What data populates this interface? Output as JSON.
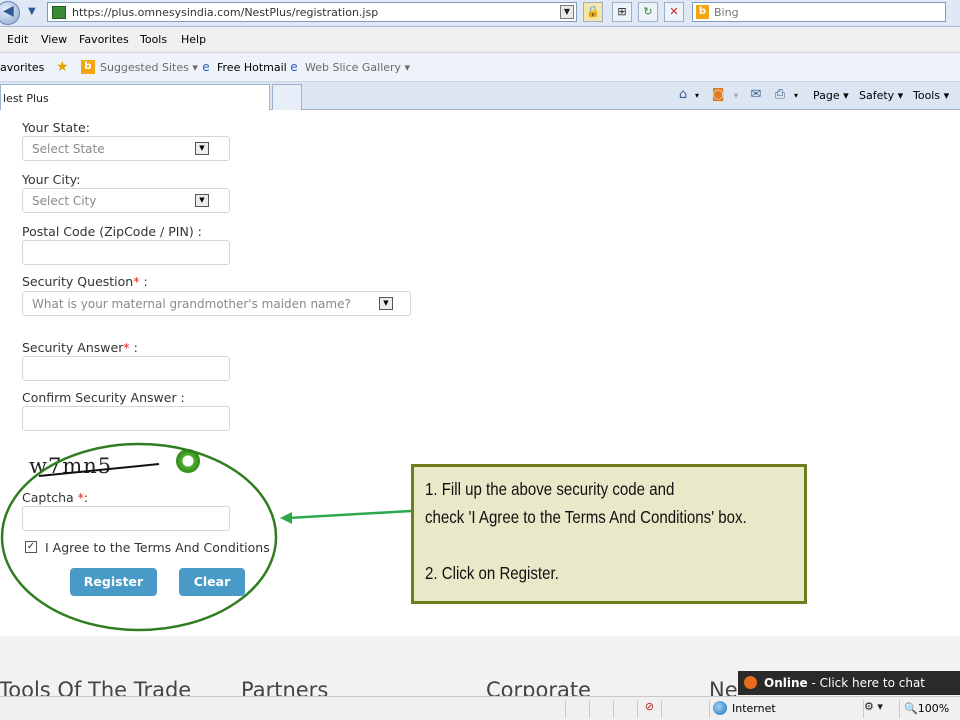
{
  "browser": {
    "url": "https://plus.omnesysindia.com/NestPlus/registration.jsp",
    "search_placeholder": "Bing",
    "menu": [
      "Edit",
      "View",
      "Favorites",
      "Tools",
      "Help"
    ],
    "favorites_label": "avorites",
    "favorites_items": [
      "Suggested Sites",
      "Free Hotmail",
      "Web Slice Gallery"
    ],
    "tab_title": "lest Plus",
    "commands": [
      "Page",
      "Safety",
      "Tools"
    ],
    "status_zone": "Internet",
    "zoom": "100%"
  },
  "form": {
    "state_label": "Your State:",
    "state_value": "Select State",
    "city_label": "Your City:",
    "city_value": "Select City",
    "postal_label": "Postal Code (ZipCode / PIN) :",
    "security_question_label": "Security Question",
    "security_question_value": "What is your maternal grandmother's maiden name?",
    "security_answer_label": "Security Answer",
    "confirm_answer_label": "Confirm Security Answer :",
    "captcha_text": "w7mn5",
    "captcha_label": "Captcha",
    "required_mark": "*",
    "suffix_colon": " :",
    "captcha_suffix": ":",
    "agree_label": "I Agree to the Terms And Conditions",
    "agree_checked": true,
    "register_label": "Register",
    "clear_label": "Clear"
  },
  "annotation": {
    "lines": [
      "1. Fill up the above security code and",
      "check 'I Agree to the Terms And Conditions' box.",
      "",
      "2. Click on Register."
    ],
    "colors": {
      "circle": "#2e7d1e",
      "arrow": "#2ea84a",
      "box_border": "#6f7d1e",
      "box_fill": "#e9e8c8"
    }
  },
  "footer": {
    "headings": [
      "Tools Of The Trade",
      "Partners",
      "Corporate",
      "Ne"
    ],
    "chat_status": "Online",
    "chat_text": " - Click here to chat"
  }
}
